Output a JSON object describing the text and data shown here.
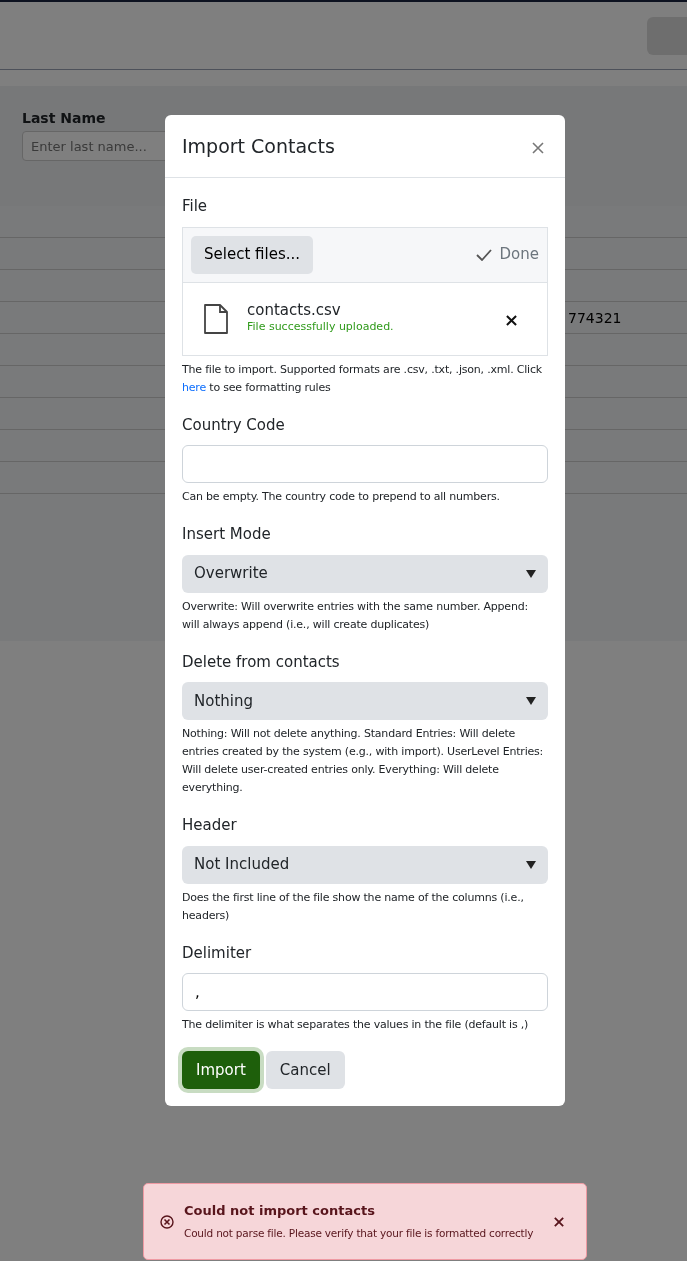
{
  "background": {
    "last_name_label": "Last Name",
    "last_name_placeholder": "Enter last name...",
    "table_cell": "774321"
  },
  "modal": {
    "title": "Import Contacts",
    "fields": [
      {
        "kind": "file",
        "label": "File",
        "select_button": "Select files...",
        "upload_status": "Done",
        "file_name": "contacts.csv",
        "file_status": "File successfully uploaded.",
        "help_before": "The file to import. Supported formats are .csv, .txt, .json, .xml. Click ",
        "help_link": "here",
        "help_after": " to see formatting rules"
      },
      {
        "kind": "text",
        "label": "Country Code",
        "help": "Can be empty. The country code to prepend to all numbers."
      },
      {
        "kind": "select",
        "label": "Insert Mode",
        "value": "Overwrite",
        "help": "Overwrite: Will overwrite entries with the same number. Append: will always append (i.e., will create duplicates)"
      },
      {
        "kind": "select",
        "label": "Delete from contacts",
        "value": "Nothing",
        "help": "Nothing: Will not delete anything. Standard Entries: Will delete entries created by the system (e.g., with import). UserLevel Entries: Will delete user-created entries only. Everything: Will delete everything."
      },
      {
        "kind": "select",
        "label": "Header",
        "value": "Not Included",
        "help": "Does the first line of the file show the name of the columns (i.e., headers)"
      },
      {
        "kind": "text",
        "label": "Delimiter",
        "value": ",",
        "help": "The delimiter is what separates the values in the file (default is ,)"
      }
    ],
    "buttons": [
      {
        "label": "Import",
        "kind": "primary"
      },
      {
        "label": "Cancel",
        "kind": "secondary"
      }
    ]
  },
  "toast": {
    "title": "Could not import contacts",
    "message": "Could not parse file. Please verify that your file is formatted correctly"
  }
}
